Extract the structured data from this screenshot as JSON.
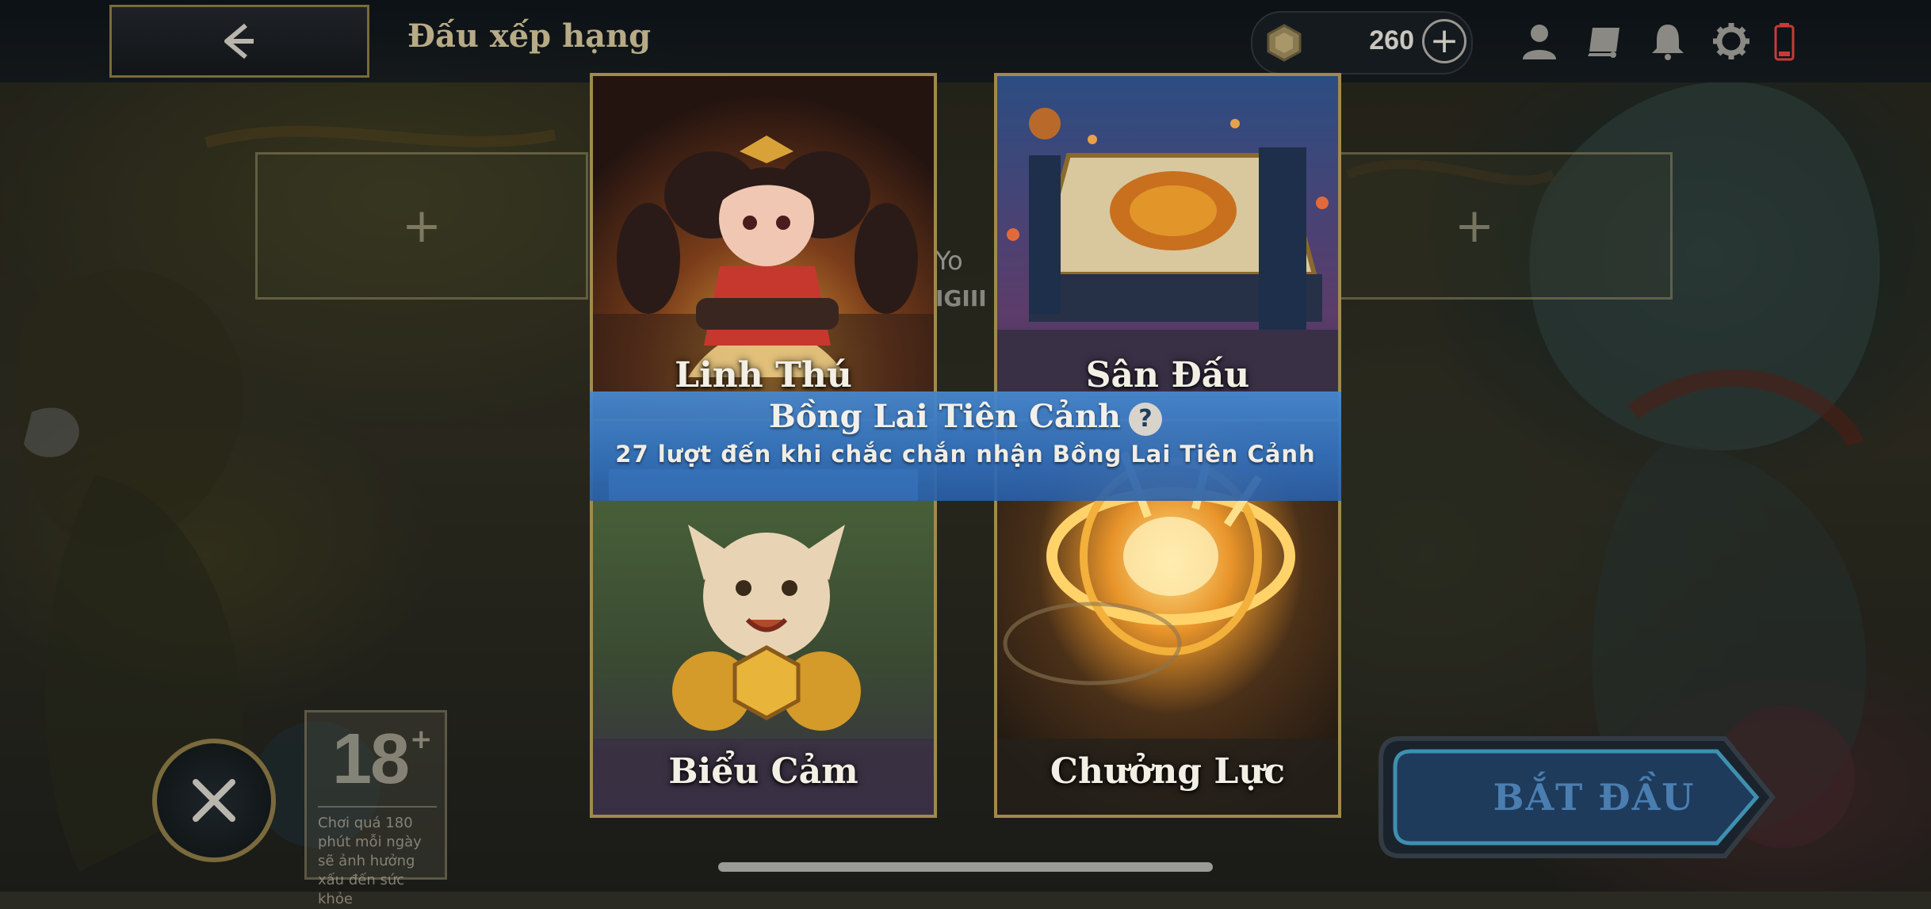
{
  "header": {
    "back_icon": "back-arrow-icon",
    "title": "Đấu xếp hạng",
    "currency": {
      "icon": "coin-icon",
      "amount": "260",
      "add_icon": "plus-icon"
    },
    "icons": [
      "profile-icon",
      "collection-icon",
      "bell-icon",
      "gear-icon",
      "battery-icon"
    ]
  },
  "lobby": {
    "player_name_partial": "e Yo",
    "player_tag_partial": "IGIII",
    "empty_slot_icon": "plus-icon"
  },
  "cards": [
    {
      "label": "Linh Thú"
    },
    {
      "label": "Sân Đấu"
    },
    {
      "label": "Biểu Cảm"
    },
    {
      "label": "Chưởng Lực"
    }
  ],
  "banner": {
    "title": "Bồng Lai Tiên Cảnh",
    "help_label": "?",
    "subtitle": "27 lượt đến khi chắc chắn nhận Bồng Lai Tiên Cảnh"
  },
  "footer": {
    "close_icon": "close-icon",
    "age_rating": {
      "number": "18",
      "plus": "+",
      "notice": "Chơi quá 180 phút mỗi ngày sẽ ảnh hưởng xấu đến sức khỏe"
    },
    "start_label": "BẮT ĐẦU"
  },
  "colors": {
    "gold_border": "#a08a4c",
    "banner_blue": "#3f7fc4",
    "start_blue": "#2a5e9a"
  }
}
